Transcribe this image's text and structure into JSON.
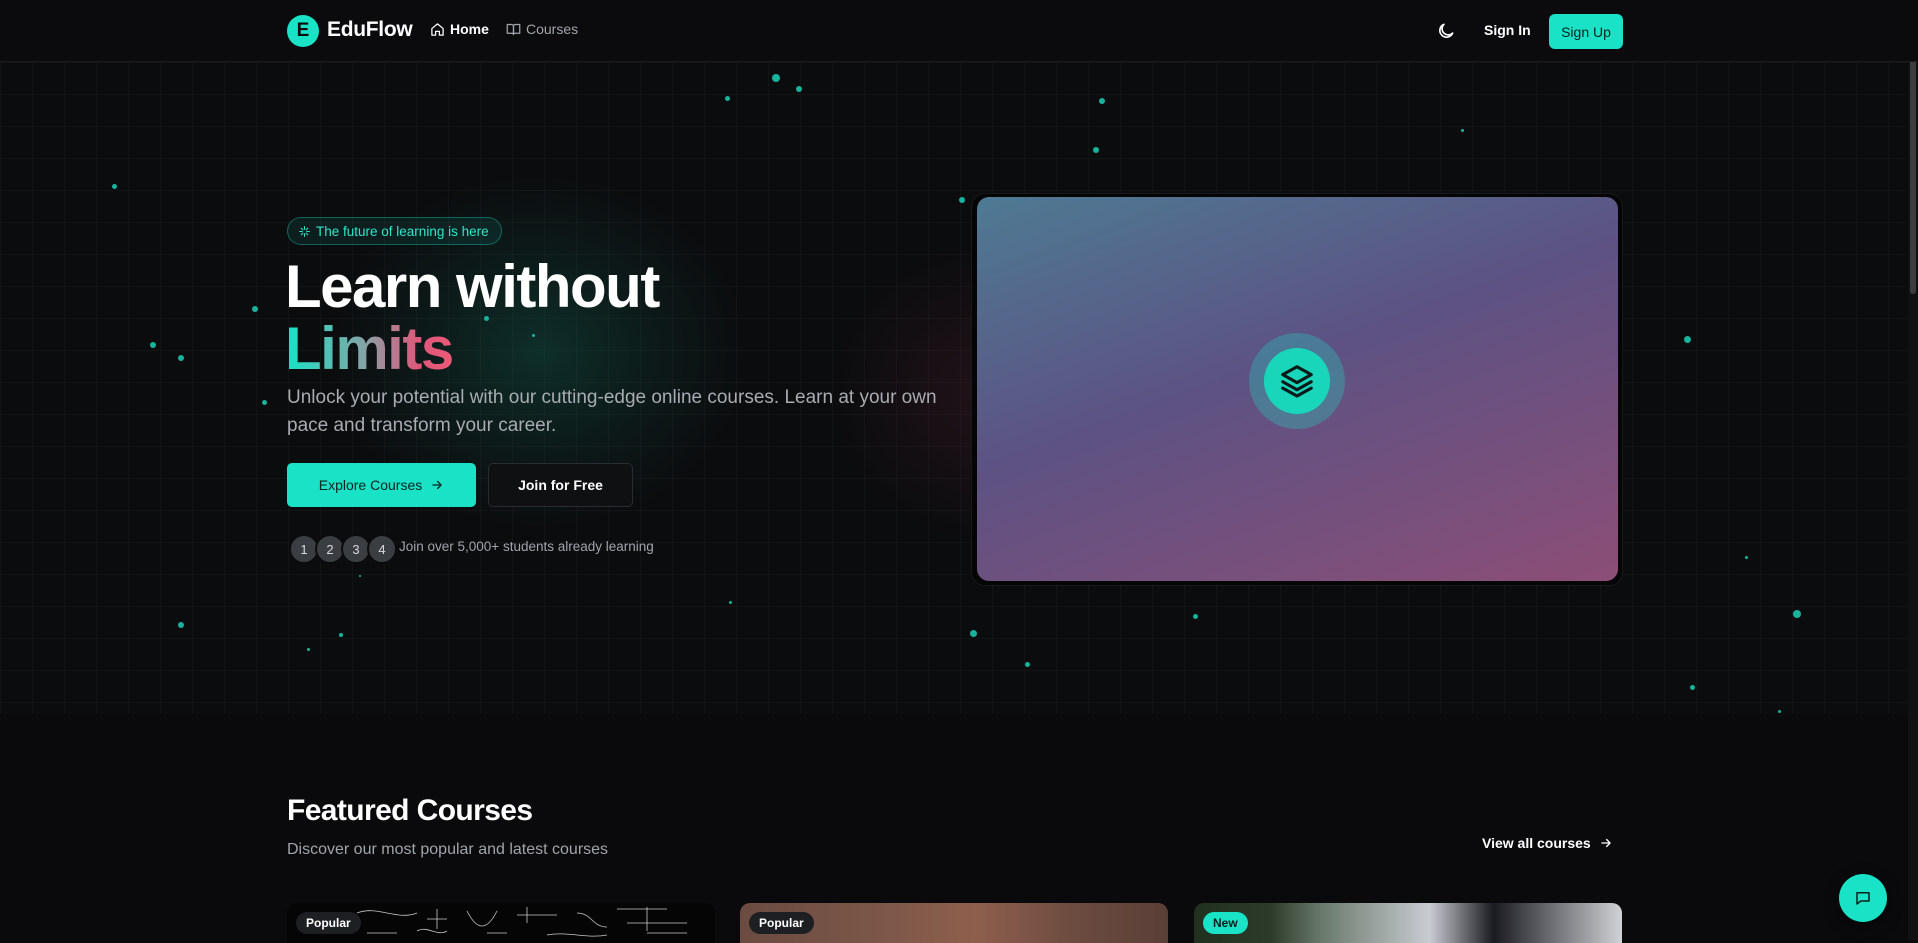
{
  "nav": {
    "logo_letter": "E",
    "brand": "EduFlow",
    "home_label": "Home",
    "courses_label": "Courses",
    "theme_icon": "moon-icon",
    "signin_label": "Sign In",
    "signup_label": "Sign Up"
  },
  "hero": {
    "badge_text": "The future of learning is here",
    "title_line1": "Learn without",
    "title_line2": "Limits",
    "subtitle": "Unlock your potential with our cutting-edge online courses. Learn at your own pace and transform your career.",
    "primary_cta": "Explore Courses",
    "secondary_cta": "Join for Free",
    "avatars": [
      "1",
      "2",
      "3",
      "4"
    ],
    "social_proof": "Join over 5,000+ students already learning",
    "media_icon": "layers-icon"
  },
  "featured": {
    "title": "Featured Courses",
    "subtitle": "Discover our most popular and latest courses",
    "view_all": "View all courses",
    "cards": [
      {
        "tag": "Popular"
      },
      {
        "tag": "Popular"
      },
      {
        "tag": "New"
      }
    ]
  },
  "colors": {
    "accent": "#19e2c6",
    "background": "#0a0a0c",
    "gradient_pink": "#e0577a"
  }
}
